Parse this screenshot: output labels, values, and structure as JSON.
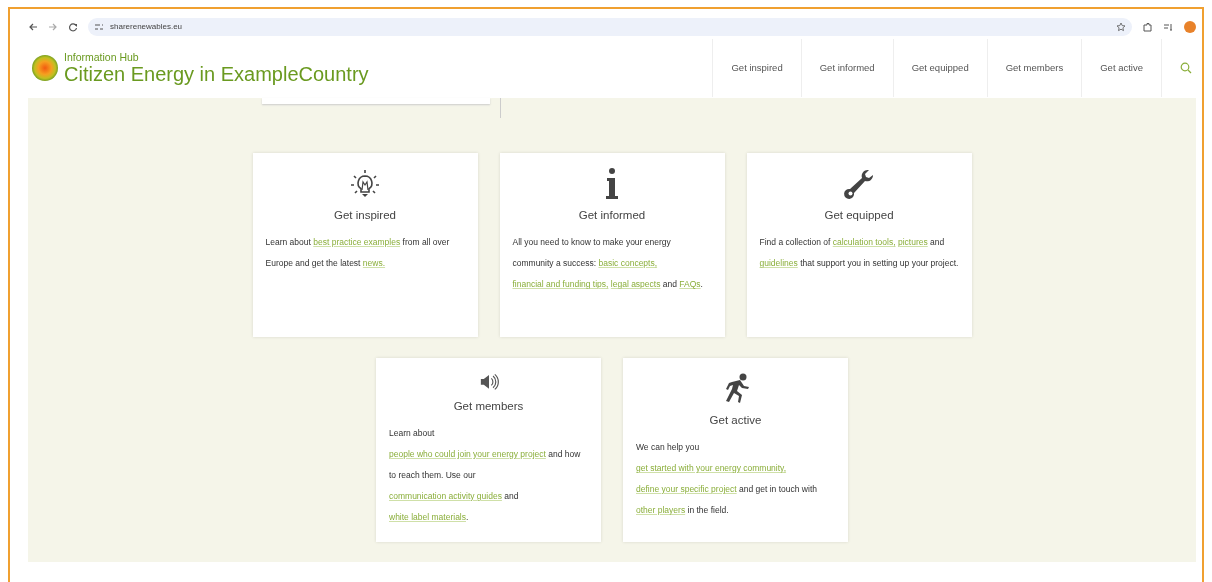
{
  "browser": {
    "url": "sharerenewables.eu"
  },
  "site": {
    "subtitle": "Information Hub",
    "title": "Citizen Energy in ExampleCountry"
  },
  "nav": [
    {
      "label": "Get inspired"
    },
    {
      "label": "Get informed"
    },
    {
      "label": "Get equipped"
    },
    {
      "label": "Get members"
    },
    {
      "label": "Get active"
    }
  ],
  "cards": [
    {
      "kind": "bulb",
      "title": "Get inspired",
      "body": [
        {
          "text": "Learn about ",
          "link": false
        },
        {
          "text": "best practice examples",
          "link": true
        },
        {
          "text": " from all over Europe and get the latest ",
          "link": false
        },
        {
          "text": "news.",
          "link": true
        }
      ]
    },
    {
      "kind": "info",
      "title": "Get informed",
      "body": [
        {
          "text": "All you need to know to make your energy community a success: ",
          "link": false
        },
        {
          "text": "basic concepts,",
          "link": true
        },
        {
          "text": "financial and funding tips,",
          "link": true
        },
        {
          "text": "legal aspects",
          "link": true
        },
        {
          "text": " and ",
          "link": false
        },
        {
          "text": "FAQs",
          "link": true
        },
        {
          "text": ".",
          "link": false
        }
      ]
    },
    {
      "kind": "wrench",
      "title": "Get equipped",
      "body": [
        {
          "text": "Find a collection of ",
          "link": false
        },
        {
          "text": "calculation tools,",
          "link": true
        },
        {
          "text": "pictures",
          "link": true
        },
        {
          "text": " and ",
          "link": false
        },
        {
          "text": "guidelines",
          "link": true
        },
        {
          "text": " that support you in setting up your project.",
          "link": false
        }
      ]
    },
    {
      "kind": "speaker",
      "title": "Get members",
      "body": [
        {
          "text": "Learn about ",
          "link": false
        },
        {
          "text": "people who could join your energy project",
          "link": true
        },
        {
          "text": " and how to reach them. Use our ",
          "link": false
        },
        {
          "text": "communication activity guides",
          "link": true
        },
        {
          "text": " and ",
          "link": false
        },
        {
          "text": "white label materials",
          "link": true
        },
        {
          "text": ".",
          "link": false
        }
      ]
    },
    {
      "kind": "runner",
      "title": "Get active",
      "body": [
        {
          "text": "We can help you ",
          "link": false
        },
        {
          "text": "get started with your energy community,",
          "link": true
        },
        {
          "text": "define your specific project",
          "link": true
        },
        {
          "text": " and get in touch with ",
          "link": false
        },
        {
          "text": "other players",
          "link": true
        },
        {
          "text": " in the field.",
          "link": false
        }
      ]
    }
  ]
}
